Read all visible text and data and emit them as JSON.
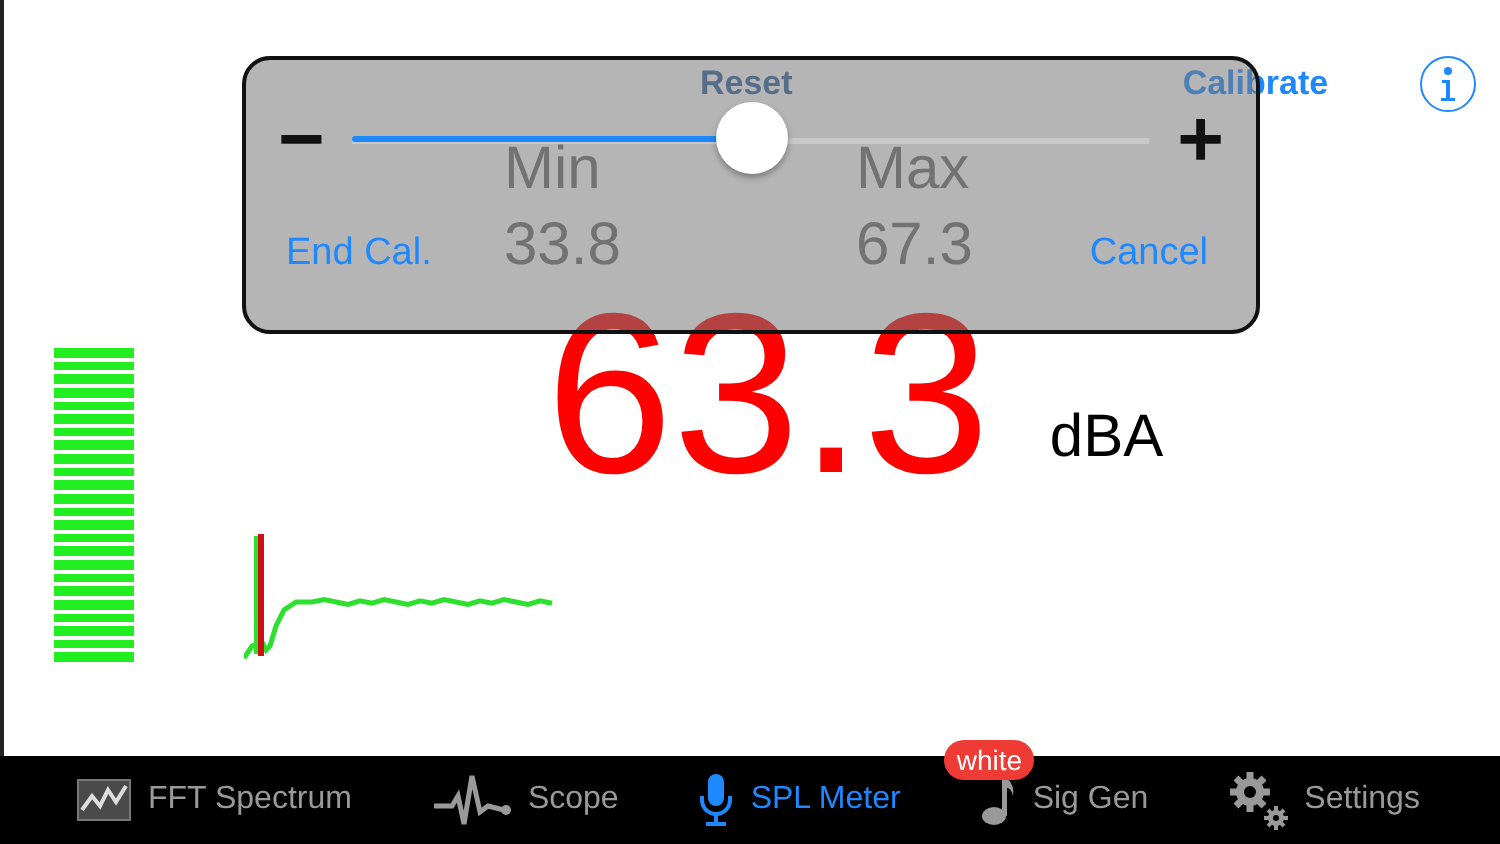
{
  "header": {
    "reset_label": "Reset",
    "calibrate_label": "Calibrate"
  },
  "range": {
    "min_label": "Min",
    "max_label": "Max",
    "min_value": "33.8",
    "max_value": "67.3"
  },
  "reading": {
    "value": "63.3",
    "unit": "dBA"
  },
  "meter": {
    "level": 1
  },
  "calibration_popup": {
    "minus": "−",
    "plus": "+",
    "slider": {
      "level": 0.5
    },
    "end_label": "End Cal.",
    "cancel_label": "Cancel"
  },
  "tabs": [
    {
      "kind": "fft",
      "label": "FFT Spectrum",
      "selected": false
    },
    {
      "kind": "scope",
      "label": "Scope",
      "selected": false
    },
    {
      "kind": "mic",
      "label": "SPL Meter",
      "selected": true
    },
    {
      "kind": "note",
      "label": "Sig Gen",
      "selected": false,
      "badge": "white"
    },
    {
      "kind": "gear",
      "label": "Settings",
      "selected": false
    }
  ]
}
